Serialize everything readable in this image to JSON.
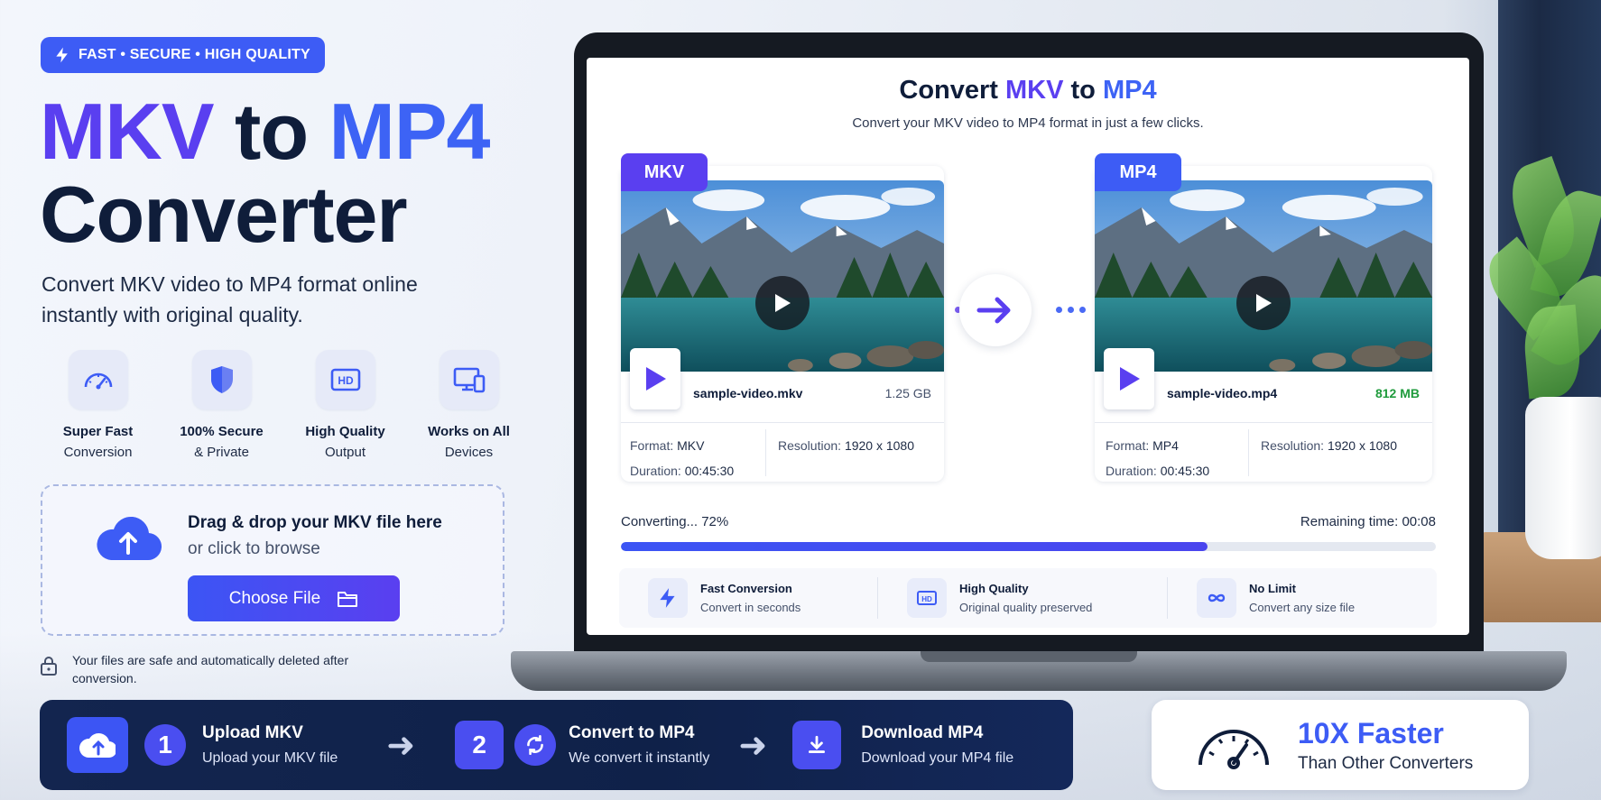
{
  "badge": {
    "text": "FAST • SECURE • HIGH QUALITY",
    "icon": "lightning-icon"
  },
  "hero": {
    "title_part1": "MKV",
    "title_part2": " to ",
    "title_part3": "MP4",
    "title_line2": "Converter",
    "subtitle": "Convert MKV video to MP4 format online instantly with original quality."
  },
  "features": [
    {
      "icon": "speedometer-icon",
      "title": "Super Fast",
      "sub": "Conversion"
    },
    {
      "icon": "shield-icon",
      "title": "100% Secure",
      "sub": "& Private"
    },
    {
      "icon": "hd-icon",
      "title": "High Quality",
      "sub": "Output"
    },
    {
      "icon": "devices-icon",
      "title": "Works on All",
      "sub": "Devices"
    }
  ],
  "dropzone": {
    "title": "Drag & drop your MKV file here",
    "sub": "or click to browse",
    "button": "Choose File"
  },
  "safe_note": "Your files are safe and automatically deleted after conversion.",
  "steps": [
    {
      "num": "1",
      "title": "Upload MKV",
      "sub": "Upload your MKV file"
    },
    {
      "num": "2",
      "title": "Convert to MP4",
      "sub": "We convert it instantly"
    },
    {
      "num": "",
      "title": "Download MP4",
      "sub": "Download your MP4 file"
    }
  ],
  "faster": {
    "title": "10X Faster",
    "sub": "Than Other Converters"
  },
  "screen": {
    "title_pre": "Convert ",
    "title_mkv": "MKV",
    "title_mid": " to ",
    "title_mp4": "MP4",
    "subtitle": "Convert your MKV video to MP4 format in just a few clicks.",
    "source": {
      "tag": "MKV",
      "file_name": "sample-video.mkv",
      "file_size": "1.25 GB",
      "format_label": "Format:",
      "format_value": "MKV",
      "resolution_label": "Resolution:",
      "resolution_value": "1920 x 1080",
      "duration_label": "Duration:",
      "duration_value": "00:45:30"
    },
    "target": {
      "tag": "MP4",
      "file_name": "sample-video.mp4",
      "file_size": "812 MB",
      "format_label": "Format:",
      "format_value": "MP4",
      "resolution_label": "Resolution:",
      "resolution_value": "1920 x 1080",
      "duration_label": "Duration:",
      "duration_value": "00:45:30"
    },
    "progress": {
      "label": "Converting... 72%",
      "percent": 72,
      "remaining": "Remaining time: 00:08"
    },
    "strip": [
      {
        "icon": "lightning-icon",
        "title": "Fast Conversion",
        "sub": "Convert in seconds"
      },
      {
        "icon": "hd-icon",
        "title": "High Quality",
        "sub": "Original quality preserved"
      },
      {
        "icon": "infinity-icon",
        "title": "No Limit",
        "sub": "Convert any size file"
      }
    ]
  },
  "colors": {
    "primary": "#3d5cf5",
    "purple": "#5a3ff0",
    "navy": "#0f1d3a",
    "green": "#1f9b3c"
  }
}
